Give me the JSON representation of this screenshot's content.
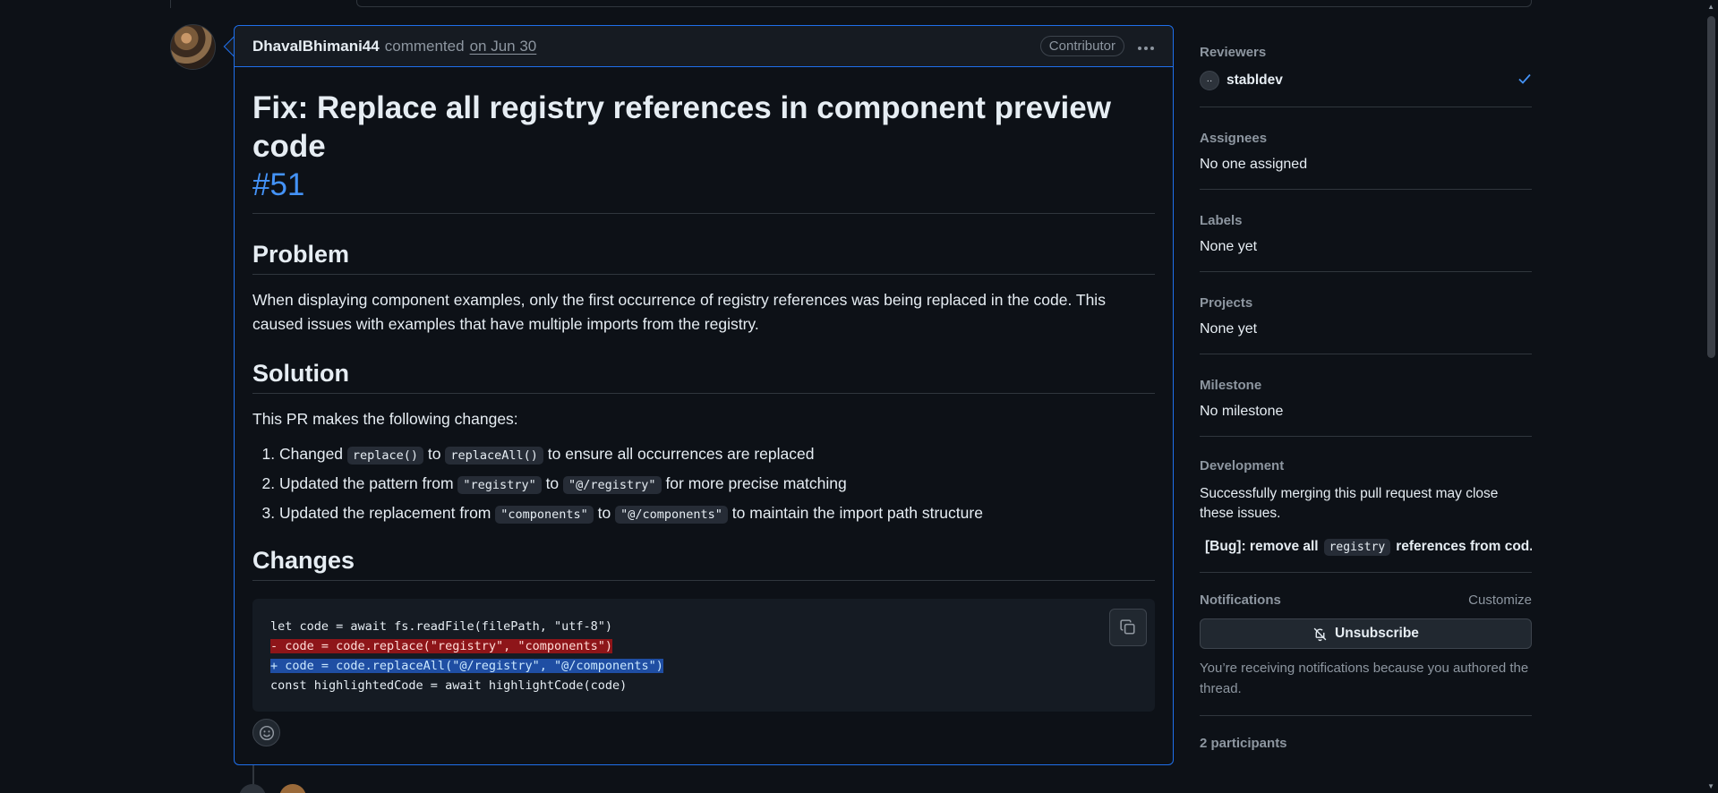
{
  "comment": {
    "author": "DhavalBhimani44",
    "action": "commented",
    "date": "on Jun 30",
    "badge": "Contributor",
    "title": "Fix: Replace all registry references in component preview code",
    "number": "#51",
    "problem": {
      "heading": "Problem",
      "text": "When displaying component examples, only the first occurrence of registry references was being replaced in the code. This caused issues with examples that have multiple imports from the registry."
    },
    "solution": {
      "heading": "Solution",
      "intro": "This PR makes the following changes:",
      "items": [
        {
          "pre": "Changed ",
          "code1": "replace()",
          "mid": " to ",
          "code2": "replaceAll()",
          "post": " to ensure all occurrences are replaced"
        },
        {
          "pre": "Updated the pattern from ",
          "code1": "\"registry\"",
          "mid": " to ",
          "code2": "\"@/registry\"",
          "post": " for more precise matching"
        },
        {
          "pre": "Updated the replacement from ",
          "code1": "\"components\"",
          "mid": " to ",
          "code2": "\"@/components\"",
          "post": " to maintain the import path structure"
        }
      ]
    },
    "changes": {
      "heading": "Changes",
      "code_lines": [
        "let code = await fs.readFile(filePath, \"utf-8\")",
        "- code = code.replace(\"registry\", \"components\")",
        "+ code = code.replaceAll(\"@/registry\", \"@/components\")",
        "const highlightedCode = await highlightCode(code)"
      ]
    }
  },
  "sidebar": {
    "reviewers": {
      "title": "Reviewers",
      "name": "stabldev"
    },
    "assignees": {
      "title": "Assignees",
      "value": "No one assigned"
    },
    "labels": {
      "title": "Labels",
      "value": "None yet"
    },
    "projects": {
      "title": "Projects",
      "value": "None yet"
    },
    "milestone": {
      "title": "Milestone",
      "value": "No milestone"
    },
    "development": {
      "title": "Development",
      "text": "Successfully merging this pull request may close these issues.",
      "issue_pre": "[Bug]: remove all",
      "issue_code": "registry",
      "issue_post": "references from cod..."
    },
    "notifications": {
      "title": "Notifications",
      "customize": "Customize",
      "button": "Unsubscribe",
      "note": "You’re receiving notifications because you authored the thread."
    },
    "participants": "2 participants"
  },
  "colors": {
    "background": "#0d1117",
    "accent": "#4493f8",
    "border_active": "#1f6feb",
    "deletion": "#8e1519",
    "addition": "#1f4ea3"
  }
}
